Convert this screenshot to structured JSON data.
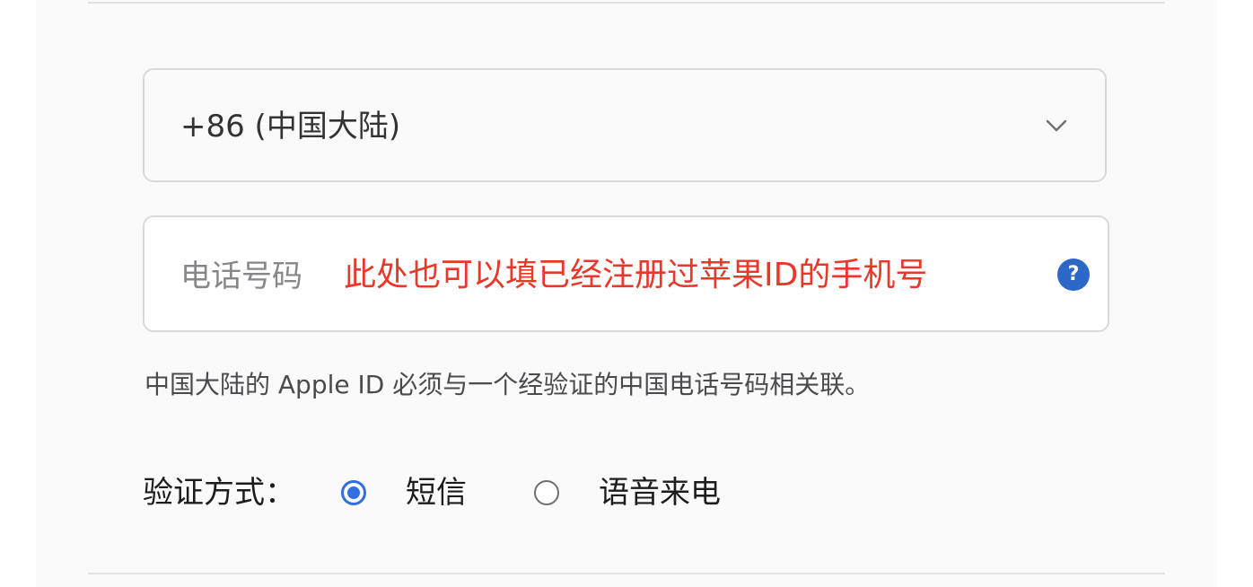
{
  "country_select": {
    "value": "+86 (中国大陆)",
    "icon": "chevron-down-icon"
  },
  "phone_field": {
    "placeholder": "电话号码",
    "annotation": "此处也可以填已经注册过苹果ID的手机号",
    "help_icon_glyph": "?",
    "help_icon_color": "#2d67c7",
    "annotation_color": "#e8382a"
  },
  "helper_text": "中国大陆的 Apple ID 必须与一个经验证的中国电话号码相关联。",
  "verification": {
    "label": "验证方式：",
    "options": [
      {
        "label": "短信",
        "selected": true
      },
      {
        "label": "语音来电",
        "selected": false
      }
    ],
    "accent_color": "#2f6fe0"
  }
}
